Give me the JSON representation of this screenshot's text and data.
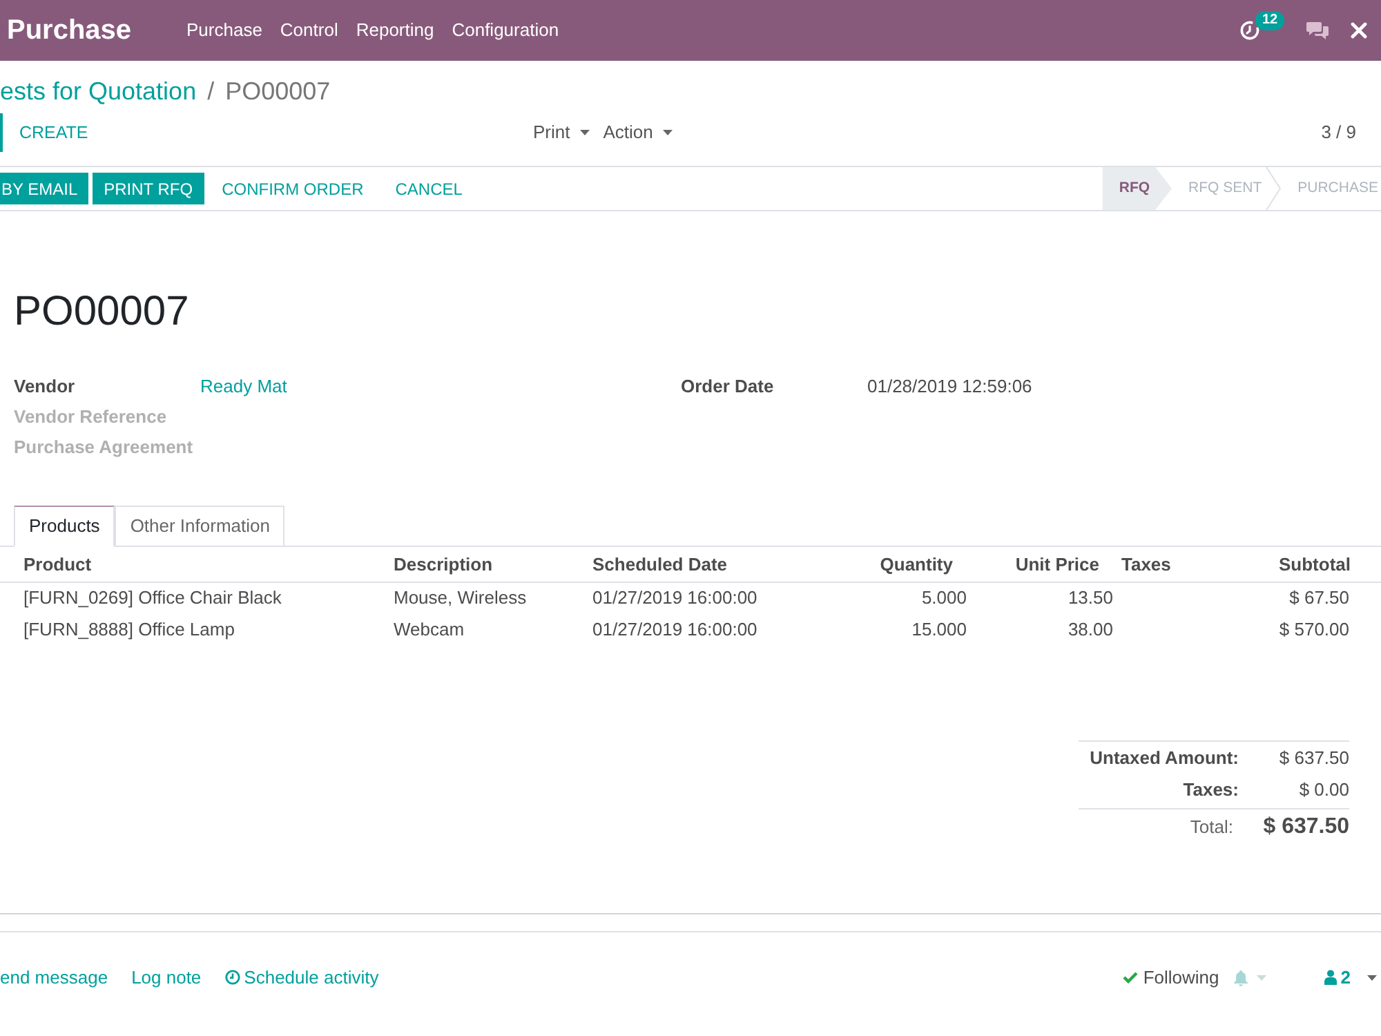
{
  "navbar": {
    "app_name": "Purchase",
    "menu": [
      "Purchase",
      "Control",
      "Reporting",
      "Configuration"
    ],
    "activity_count": "12"
  },
  "breadcrumb": {
    "parent": "ests for Quotation",
    "separator": "/",
    "current": "PO00007"
  },
  "control_panel": {
    "create": "CREATE",
    "dropdowns": [
      "Print",
      "Action"
    ],
    "pager": "3 / 9"
  },
  "statusbar": {
    "buttons": [
      {
        "label": "BY EMAIL",
        "kind": "primary"
      },
      {
        "label": "PRINT RFQ",
        "kind": "primary"
      },
      {
        "label": "CONFIRM ORDER",
        "kind": "link"
      },
      {
        "label": "CANCEL",
        "kind": "link"
      }
    ],
    "stages": [
      {
        "label": "RFQ",
        "selected": true
      },
      {
        "label": "RFQ SENT",
        "selected": false
      },
      {
        "label": "PURCHASE",
        "selected": false
      }
    ]
  },
  "form": {
    "title": "PO00007",
    "left_fields": [
      {
        "label": "Vendor",
        "value": "Ready Mat",
        "kind": "link"
      },
      {
        "label": "Vendor Reference"
      },
      {
        "label": "Purchase Agreement"
      }
    ],
    "right_fields": [
      {
        "label": "Order Date",
        "value": "01/28/2019 12:59:06",
        "kind": "text"
      }
    ]
  },
  "tabs": [
    {
      "label": "Products",
      "selected": true
    },
    {
      "label": "Other Information",
      "selected": false
    }
  ],
  "table": {
    "columns": [
      "Product",
      "Description",
      "Scheduled Date",
      "Quantity",
      "Unit Price",
      "Taxes",
      "Subtotal"
    ],
    "rows": [
      {
        "product": "[FURN_0269] Office Chair Black",
        "description": "Mouse, Wireless",
        "scheduled_date": "01/27/2019 16:00:00",
        "quantity": "5.000",
        "unit_price": "13.50",
        "subtotal": "$ 67.50"
      },
      {
        "product": "[FURN_8888] Office Lamp",
        "description": "Webcam",
        "scheduled_date": "01/27/2019 16:00:00",
        "quantity": "15.000",
        "unit_price": "38.00",
        "subtotal": "$ 570.00"
      }
    ]
  },
  "totals": {
    "lines": [
      {
        "label": "Untaxed Amount:",
        "value": "$ 637.50"
      },
      {
        "label": "Taxes:",
        "value": "$ 0.00"
      }
    ],
    "total": {
      "label": "Total:",
      "value": "$ 637.50"
    }
  },
  "chatter": {
    "actions": [
      {
        "label": "end message",
        "kind": "text"
      },
      {
        "label": "Log note",
        "kind": "text"
      },
      {
        "label": "Schedule activity",
        "kind": "activity"
      }
    ],
    "following": "Following",
    "followers_count": "2"
  }
}
